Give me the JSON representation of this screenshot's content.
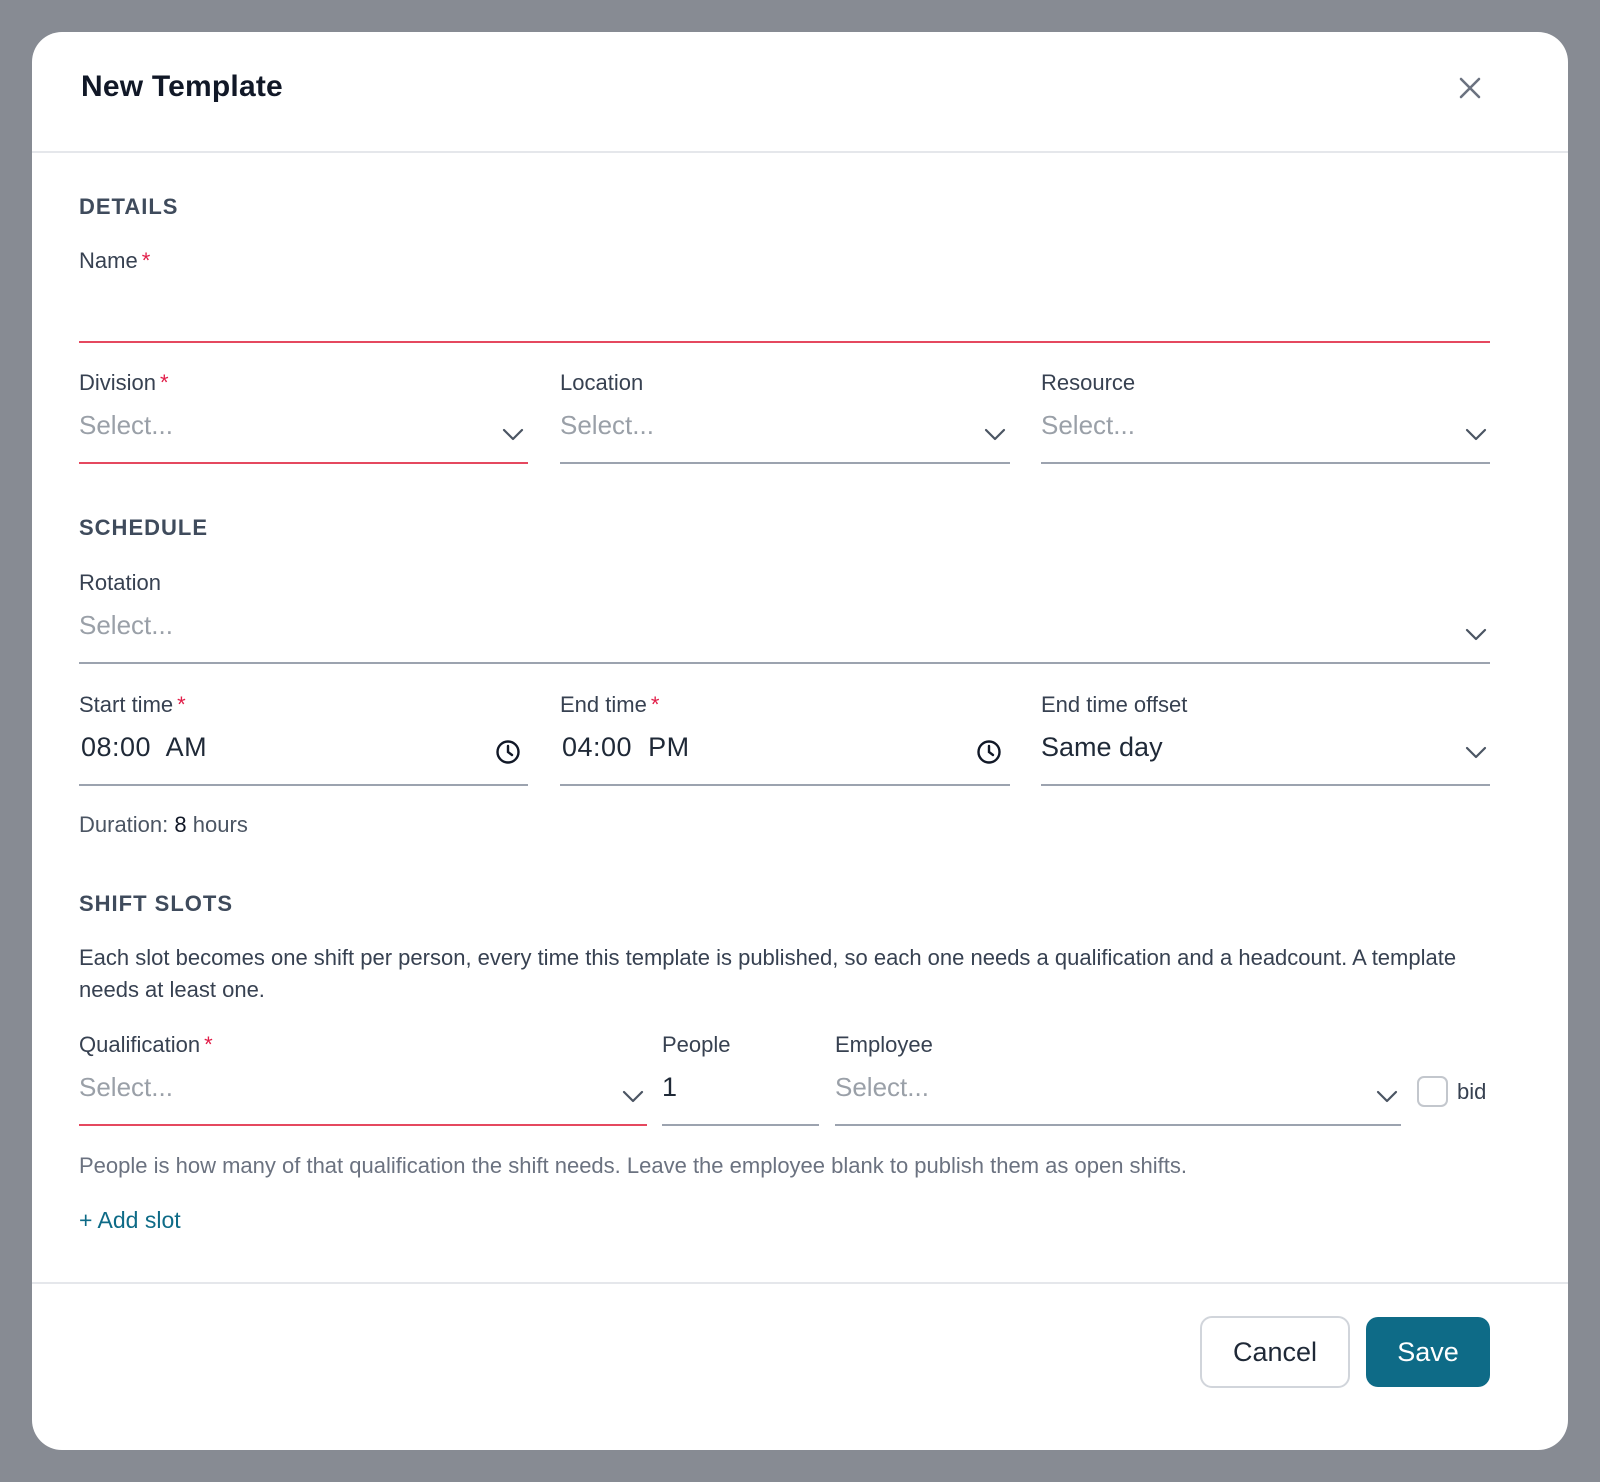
{
  "modal": {
    "title": "New Template",
    "close_icon": "close-icon"
  },
  "details": {
    "heading": "DETAILS",
    "name": {
      "label": "Name",
      "required_mark": "*",
      "value": ""
    },
    "division": {
      "label": "Division",
      "required_mark": "*",
      "placeholder": "Select..."
    },
    "location": {
      "label": "Location",
      "placeholder": "Select..."
    },
    "resource": {
      "label": "Resource",
      "placeholder": "Select..."
    }
  },
  "schedule": {
    "heading": "SCHEDULE",
    "rotation": {
      "label": "Rotation",
      "placeholder": "Select..."
    },
    "start_time": {
      "label": "Start time",
      "required_mark": "*",
      "value": "08:00  AM"
    },
    "end_time": {
      "label": "End time",
      "required_mark": "*",
      "value": "04:00  PM"
    },
    "end_time_offset": {
      "label": "End time offset",
      "value": "Same day"
    },
    "duration": {
      "prefix": "Duration:",
      "number": "8",
      "unit": "hours"
    }
  },
  "shift_slots": {
    "heading": "SHIFT SLOTS",
    "description": "Each slot becomes one shift per person, every time this template is published, so each one needs a qualification and a headcount. A template needs at least one.",
    "qualification": {
      "label": "Qualification",
      "required_mark": "*",
      "placeholder": "Select..."
    },
    "people": {
      "label": "People",
      "value": "1"
    },
    "employee": {
      "label": "Employee",
      "placeholder": "Select..."
    },
    "bid": {
      "label": "bid",
      "checked": false
    },
    "help_text": "People is how many of that qualification the shift needs. Leave the employee blank to publish them as open shifts.",
    "add_slot": "+ Add slot"
  },
  "footer": {
    "cancel": "Cancel",
    "save": "Save"
  },
  "colors": {
    "accent": "#0e6b87",
    "error": "#e5485f",
    "backdrop": "#878b93"
  }
}
